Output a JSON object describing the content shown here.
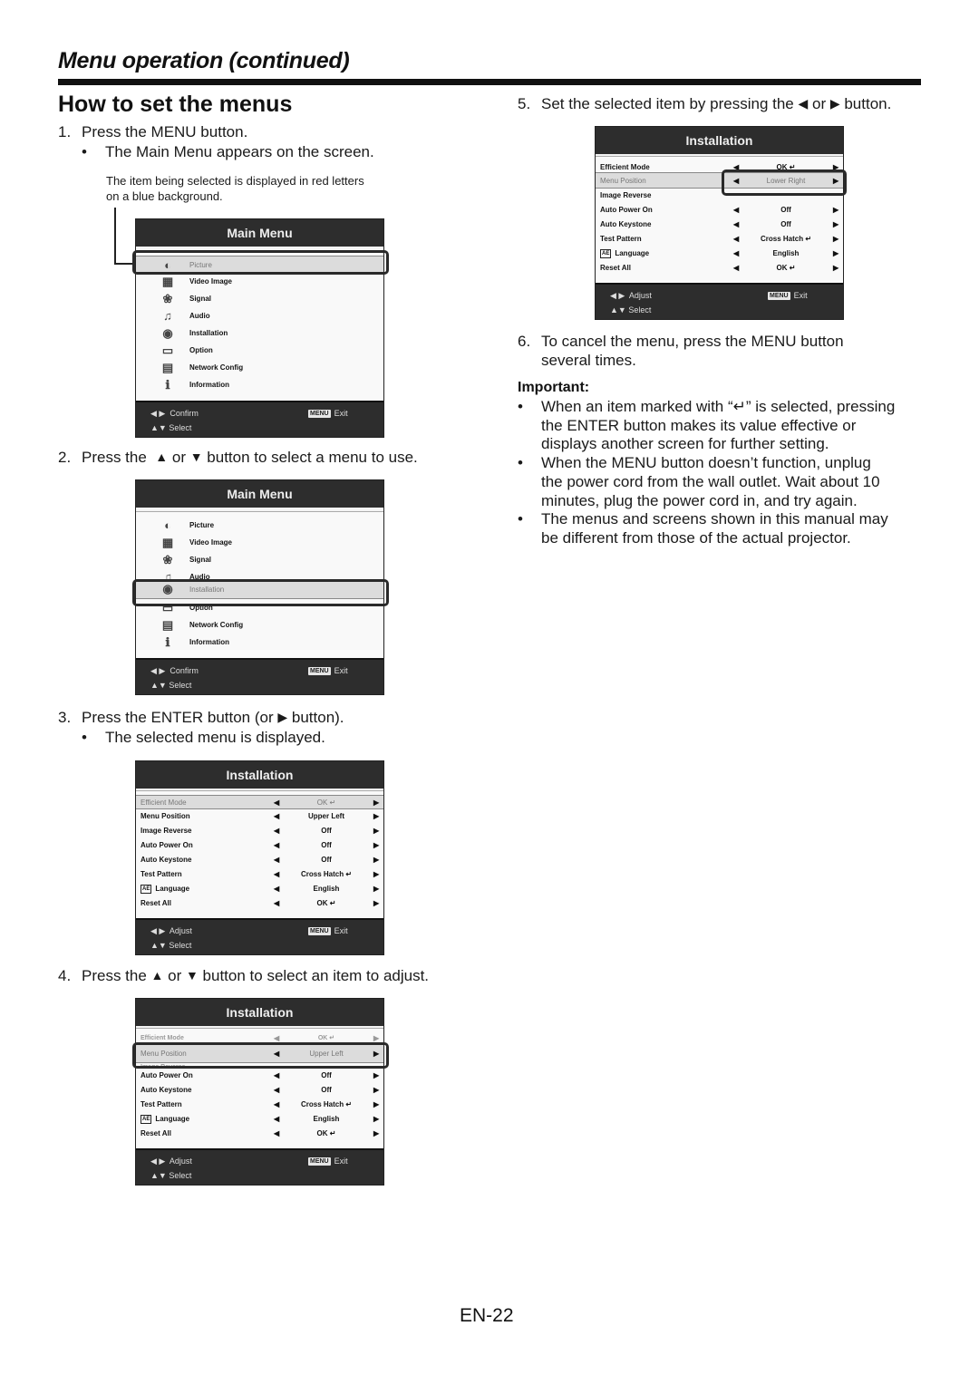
{
  "section_title": "Menu operation (continued)",
  "page_heading": "How to set the menus",
  "steps": {
    "s1": {
      "num": "1.",
      "text": "Press the MENU button.",
      "bullet": "The Main Menu appears on the screen.",
      "note_line1": "The item being selected is displayed in red letters",
      "note_line2": "on a blue background."
    },
    "s2": {
      "num": "2.",
      "pre": "Press the ",
      "up": "▲",
      "mid": " or ",
      "down": "▼",
      "post": " button to select a menu to use."
    },
    "s3": {
      "num": "3.",
      "pre": "Press the ENTER button (or ",
      "right": "▶",
      "post": " button).",
      "bullet": "The selected menu is displayed."
    },
    "s4": {
      "num": "4.",
      "pre": "Press the ",
      "up": "▲",
      "mid": " or ",
      "down": "▼",
      "post": " button to select an item to adjust."
    },
    "s5": {
      "num": "5.",
      "pre": "Set the selected item by pressing the ",
      "left": "◀",
      "mid": " or ",
      "right": "▶",
      "post": " button."
    },
    "s6": {
      "num": "6.",
      "line1": "To cancel the menu, press the MENU button",
      "line2": "several times."
    }
  },
  "bullet_char": "•",
  "important": {
    "title": "Important:",
    "items": [
      {
        "lines": [
          "When an item marked with “↵” is selected, pressing",
          "the ENTER button makes its value effective or",
          "displays another screen for further setting."
        ]
      },
      {
        "lines": [
          "When the MENU button doesn’t function, unplug",
          "the power cord from the wall outlet. Wait about 10",
          "minutes, plug the power cord in, and try again."
        ]
      },
      {
        "lines": [
          "The menus and screens shown in this manual may",
          "be different from those of the actual projector."
        ]
      }
    ]
  },
  "main_menu": {
    "title": "Main Menu",
    "items": [
      {
        "label": "Picture",
        "icon": "◐"
      },
      {
        "label": "Video Image",
        "icon": "▦"
      },
      {
        "label": "Signal",
        "icon": "❀"
      },
      {
        "label": "Audio",
        "icon": "♫"
      },
      {
        "label": "Installation",
        "icon": "◉"
      },
      {
        "label": "Option",
        "icon": "▭"
      },
      {
        "label": "Network Config",
        "icon": "▤"
      },
      {
        "label": "Information",
        "icon": "ℹ"
      }
    ],
    "footer": {
      "nav_arrows": "◀ ▶",
      "confirm": "Confirm",
      "select_arrows": "▲▼",
      "select": "Select",
      "menu_key": "MENU",
      "exit": "Exit"
    }
  },
  "installation_menu": {
    "title": "Installation",
    "left_arrow": "◀",
    "right_arrow": "▶",
    "lang_icon": "AE",
    "items": [
      {
        "label": "Efficient Mode",
        "value": "OK ↵"
      },
      {
        "label": "Menu Position",
        "value": "Upper Left"
      },
      {
        "label": "Image Reverse",
        "value": "Off"
      },
      {
        "label": "Auto Power On",
        "value": "Off"
      },
      {
        "label": "Auto Keystone",
        "value": "Off"
      },
      {
        "label": "Test Pattern",
        "value": "Cross Hatch ↵"
      },
      {
        "label": "Language",
        "value": "English"
      },
      {
        "label": "Reset All",
        "value": "OK ↵"
      }
    ],
    "menu_position_changed_value": "Lower Right",
    "footer": {
      "nav_arrows": "◀ ▶",
      "adjust": "Adjust",
      "select_arrows": "▲▼",
      "select": "Select",
      "menu_key": "MENU",
      "exit": "Exit"
    }
  },
  "page_number": "EN-22"
}
